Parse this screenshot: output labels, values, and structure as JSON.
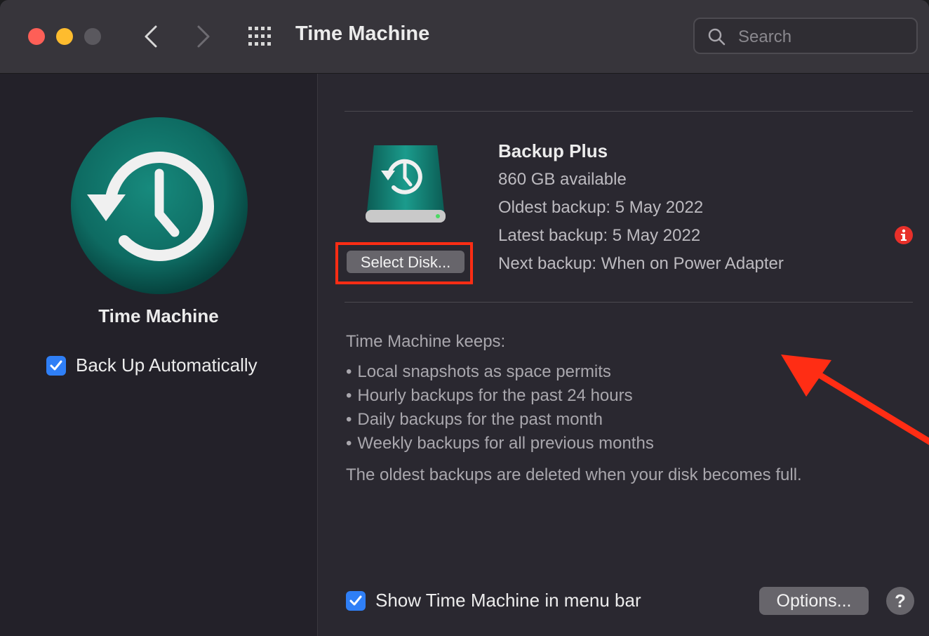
{
  "window": {
    "title": "Time Machine",
    "search_placeholder": "Search"
  },
  "sidebar": {
    "title": "Time Machine",
    "back_up_automatically_label": "Back Up Automatically",
    "back_up_automatically_checked": true
  },
  "disk": {
    "name": "Backup Plus",
    "available": "860 GB available",
    "oldest_backup": "Oldest backup: 5 May 2022",
    "latest_backup": "Latest backup: 5 May 2022",
    "next_backup": "Next backup: When on Power Adapter",
    "select_disk_label": "Select Disk..."
  },
  "keeps": {
    "title": "Time Machine keeps:",
    "items": [
      "Local snapshots as space permits",
      "Hourly backups for the past 24 hours",
      "Daily backups for the past month",
      "Weekly backups for all previous months"
    ],
    "note": "The oldest backups are deleted when your disk becomes full."
  },
  "footer": {
    "show_in_menu_bar_label": "Show Time Machine in menu bar",
    "show_in_menu_bar_checked": true,
    "options_label": "Options...",
    "help_label": "?"
  },
  "colors": {
    "accent_blue": "#2f7ff6",
    "annotation_red": "#ff2d14",
    "teal_icon": "#0e6b62"
  },
  "icons": [
    "close-light",
    "minimize-light",
    "zoom-light",
    "back-chevron-icon",
    "forward-chevron-icon",
    "grid-icon",
    "search-icon",
    "time-machine-icon",
    "backup-disk-icon",
    "info-icon",
    "checkmark-icon"
  ]
}
